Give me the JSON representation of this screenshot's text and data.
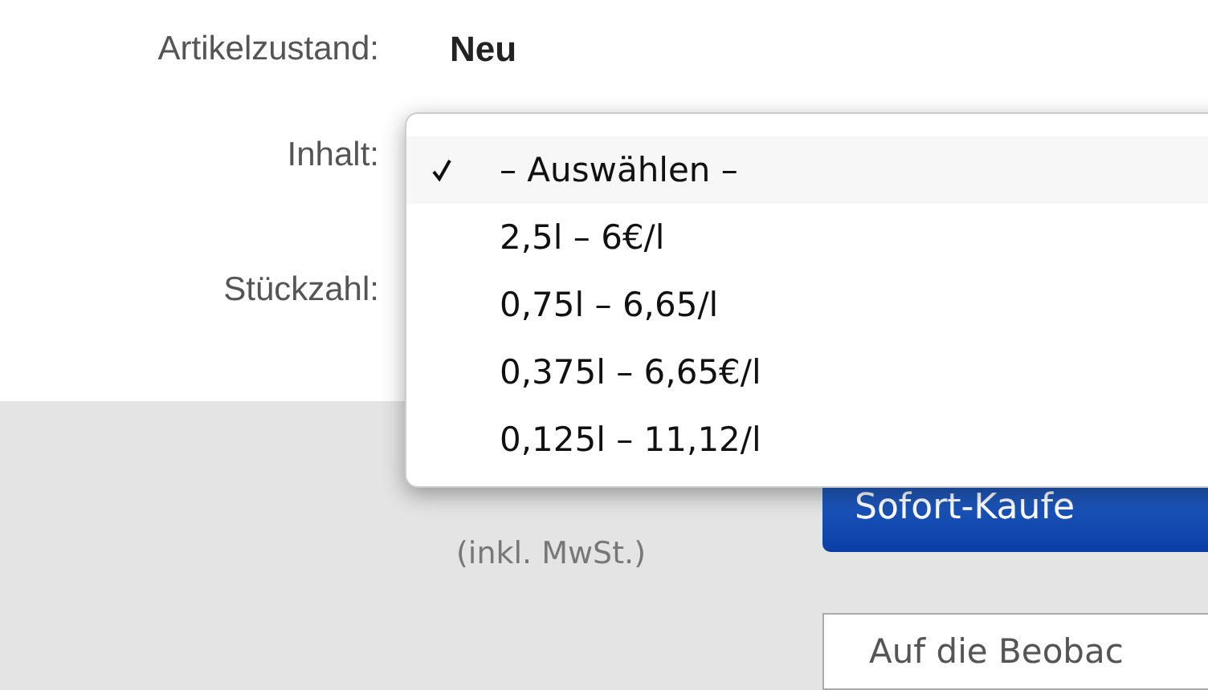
{
  "fields": [
    {
      "label": "Artikelzustand:",
      "value": "Neu"
    },
    {
      "label": "Inhalt:"
    },
    {
      "label": "Stückzahl:"
    }
  ],
  "dropdown_menu": {
    "options": [
      {
        "label": "– Auswählen –",
        "selected": true
      },
      {
        "label": "2,5l – 6€/l",
        "selected": false
      },
      {
        "label": "0,75l – 6,65/l",
        "selected": false
      },
      {
        "label": "0,375l – 6,65€/l",
        "selected": false
      },
      {
        "label": "0,125l – 11,12/l",
        "selected": false
      }
    ]
  },
  "purchase": {
    "tax_note": "(inkl. MwSt.)",
    "buy_button": "Sofort-Kaufe",
    "watch_button": "Auf die Beobac"
  }
}
